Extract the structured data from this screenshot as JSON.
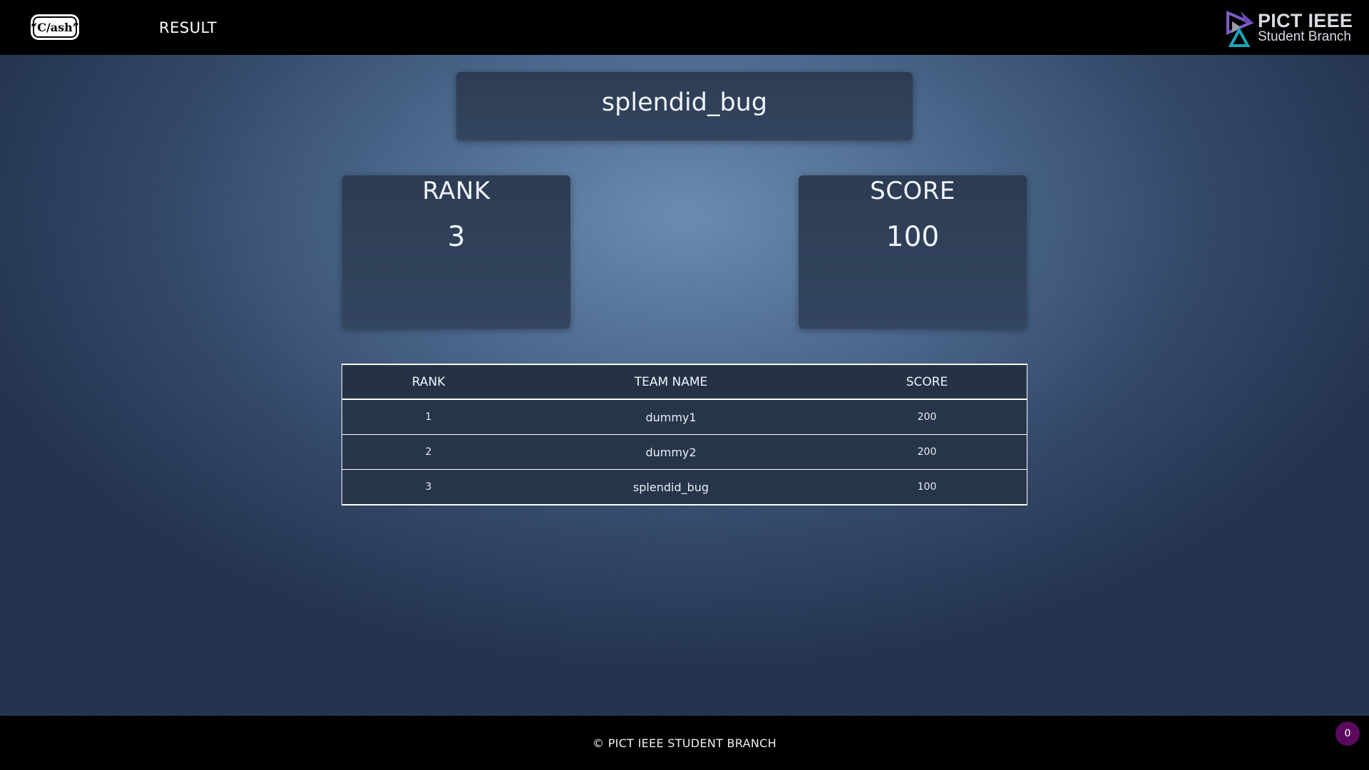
{
  "header": {
    "logo_text": "“C/ash”",
    "nav_result": "RESULT",
    "brand_title": "PICT IEEE",
    "brand_sub": "Student Branch"
  },
  "team": {
    "name": "splendid_bug"
  },
  "stats": {
    "rank_label": "RANK",
    "rank_value": "3",
    "score_label": "SCORE",
    "score_value": "100"
  },
  "leaderboard": {
    "headers": [
      "RANK",
      "TEAM NAME",
      "SCORE"
    ],
    "rows": [
      {
        "rank": "1",
        "team": "dummy1",
        "score": "200"
      },
      {
        "rank": "2",
        "team": "dummy2",
        "score": "200"
      },
      {
        "rank": "3",
        "team": "splendid_bug",
        "score": "100"
      }
    ]
  },
  "footer": {
    "copyright": "© PICT IEEE STUDENT BRANCH",
    "badge_count": "0"
  },
  "colors": {
    "bar": "#000000",
    "card": "#2c3c54",
    "badge": "#5a0a5e",
    "brand_purple": "#6a4bb0",
    "brand_teal": "#1aa6b7"
  }
}
